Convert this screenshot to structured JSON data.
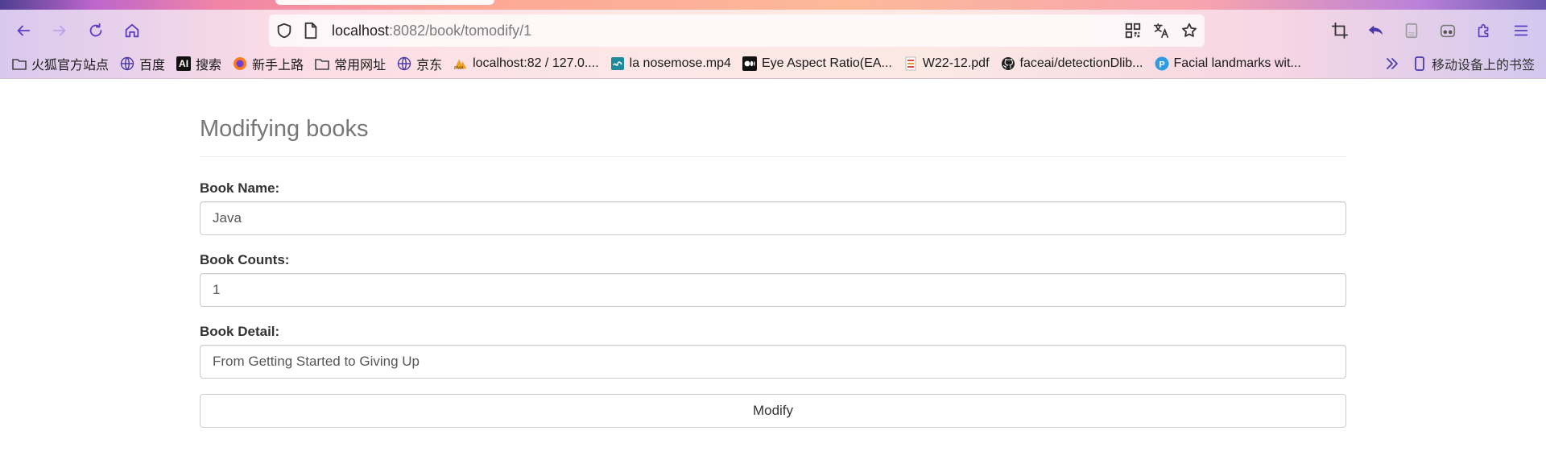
{
  "browser": {
    "url_host": "localhost",
    "url_path": ":8082/book/tomodify/1",
    "bookmarks": [
      {
        "label": "火狐官方站点",
        "icon": "folder-icon"
      },
      {
        "label": "百度",
        "icon": "globe-icon"
      },
      {
        "label": "搜索",
        "icon": "ai-icon"
      },
      {
        "label": "新手上路",
        "icon": "firefox-icon"
      },
      {
        "label": "常用网址",
        "icon": "folder-icon"
      },
      {
        "label": "京东",
        "icon": "globe-icon"
      },
      {
        "label": "localhost:82 / 127.0....",
        "icon": "pma-icon"
      },
      {
        "label": "la nosemose.mp4",
        "icon": "video-icon"
      },
      {
        "label": "Eye Aspect Ratio(EA...",
        "icon": "medium-icon"
      },
      {
        "label": "W22-12.pdf",
        "icon": "pdf-icon"
      },
      {
        "label": "faceai/detectionDlib...",
        "icon": "github-icon"
      },
      {
        "label": "Facial landmarks wit...",
        "icon": "p-icon"
      }
    ],
    "mobile_bookmarks": "移动设备上的书签"
  },
  "page": {
    "title": "Modifying books",
    "fields": {
      "name_label": "Book Name:",
      "name_value": "Java",
      "counts_label": "Book Counts:",
      "counts_value": "1",
      "detail_label": "Book Detail:",
      "detail_value": "From Getting Started to Giving Up"
    },
    "submit_label": "Modify"
  }
}
